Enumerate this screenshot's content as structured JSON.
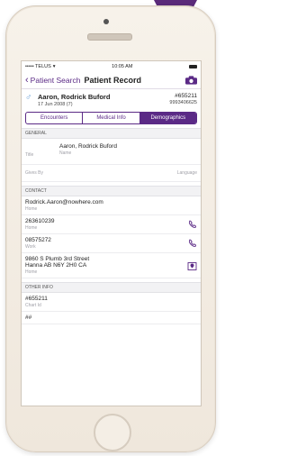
{
  "status": {
    "carrier": "••••• TELUS",
    "time": "10:05 AM"
  },
  "nav": {
    "back_label": "Patient Search",
    "title": "Patient Record"
  },
  "patient": {
    "name": "Aaron, Rodrick Buford",
    "dob": "17 Jun 2008 (7)",
    "id": "#655211",
    "phone_id": "9993406625"
  },
  "tabs": [
    {
      "label": "Encounters"
    },
    {
      "label": "Medical Info"
    },
    {
      "label": "Demographics"
    }
  ],
  "general": {
    "header": "GENERAL",
    "title_label": "Title",
    "name_value": "Aaron, Rodrick Buford",
    "name_label": "Name",
    "gives_by_label": "Gives By",
    "language_label": "Language"
  },
  "contact": {
    "header": "CONTACT",
    "items": [
      {
        "value": "Rodrick.Aaron@nowhere.com",
        "label": "Home"
      },
      {
        "value": "263610239",
        "label": "Home",
        "icon": "phone-icon"
      },
      {
        "value": "08575272",
        "label": "Work",
        "icon": "phone-icon"
      },
      {
        "value": "9860 S Plumb 3rd Street\nHanna AB N6Y 2H0 CA",
        "label": "Home",
        "icon": "map-icon"
      }
    ]
  },
  "other": {
    "header": "OTHER INFO",
    "chart_value": "#655211",
    "chart_label": "Chart Id",
    "partial_value": "##"
  },
  "colors": {
    "accent": "#5b2a86",
    "corner": "#5a2a7a"
  }
}
